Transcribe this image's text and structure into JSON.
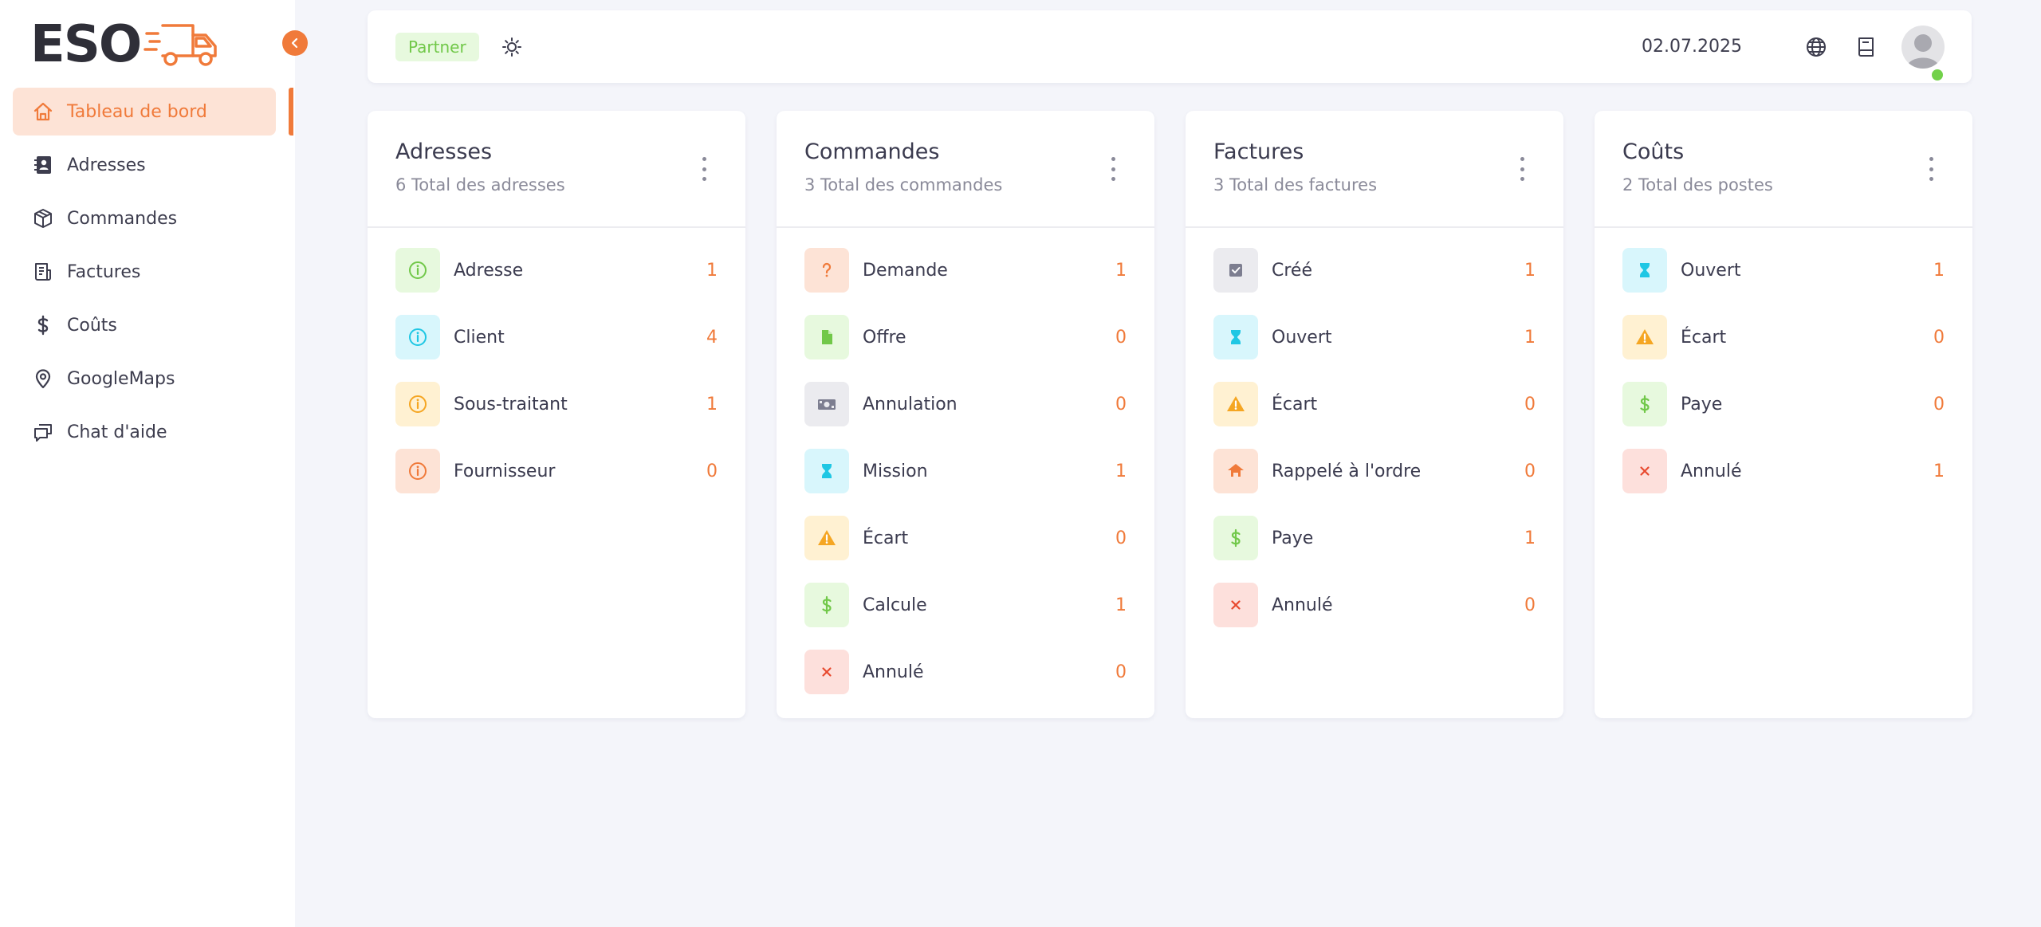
{
  "sidebar": {
    "logo_text": "ESO",
    "items": [
      {
        "label": "Tableau de bord",
        "icon": "home-icon"
      },
      {
        "label": "Adresses",
        "icon": "address-book-icon"
      },
      {
        "label": "Commandes",
        "icon": "package-icon"
      },
      {
        "label": "Factures",
        "icon": "invoice-icon"
      },
      {
        "label": "Coûts",
        "icon": "dollar-icon"
      },
      {
        "label": "GoogleMaps",
        "icon": "map-pin-icon"
      },
      {
        "label": "Chat d'aide",
        "icon": "chat-icon"
      }
    ]
  },
  "header": {
    "badge": "Partner",
    "date": "02.07.2025"
  },
  "cards": [
    {
      "title": "Adresses",
      "subtitle": "6 Total des adresses",
      "rows": [
        {
          "label": "Adresse",
          "count": "1",
          "icon": "info-icon",
          "tone": "green"
        },
        {
          "label": "Client",
          "count": "4",
          "icon": "info-icon",
          "tone": "cyan"
        },
        {
          "label": "Sous-traitant",
          "count": "1",
          "icon": "info-icon",
          "tone": "yellow"
        },
        {
          "label": "Fournisseur",
          "count": "0",
          "icon": "info-icon",
          "tone": "orange"
        }
      ]
    },
    {
      "title": "Commandes",
      "subtitle": "3 Total des commandes",
      "rows": [
        {
          "label": "Demande",
          "count": "1",
          "icon": "question-icon",
          "tone": "orange"
        },
        {
          "label": "Offre",
          "count": "0",
          "icon": "file-icon",
          "tone": "green"
        },
        {
          "label": "Annulation",
          "count": "0",
          "icon": "money-icon",
          "tone": "grey"
        },
        {
          "label": "Mission",
          "count": "1",
          "icon": "hourglass-icon",
          "tone": "cyan"
        },
        {
          "label": "Écart",
          "count": "0",
          "icon": "warning-icon",
          "tone": "yellow"
        },
        {
          "label": "Calcule",
          "count": "1",
          "icon": "dollar-icon",
          "tone": "green"
        },
        {
          "label": "Annulé",
          "count": "0",
          "icon": "close-icon",
          "tone": "red"
        }
      ]
    },
    {
      "title": "Factures",
      "subtitle": "3 Total des factures",
      "rows": [
        {
          "label": "Créé",
          "count": "1",
          "icon": "checkbox-icon",
          "tone": "grey"
        },
        {
          "label": "Ouvert",
          "count": "1",
          "icon": "hourglass-icon",
          "tone": "cyan"
        },
        {
          "label": "Écart",
          "count": "0",
          "icon": "warning-icon",
          "tone": "yellow"
        },
        {
          "label": "Rappelé à l'ordre",
          "count": "0",
          "icon": "reminder-icon",
          "tone": "orange"
        },
        {
          "label": "Paye",
          "count": "1",
          "icon": "dollar-icon",
          "tone": "green"
        },
        {
          "label": "Annulé",
          "count": "0",
          "icon": "close-icon",
          "tone": "red"
        }
      ]
    },
    {
      "title": "Coûts",
      "subtitle": "2 Total des postes",
      "rows": [
        {
          "label": "Ouvert",
          "count": "1",
          "icon": "hourglass-icon",
          "tone": "cyan"
        },
        {
          "label": "Écart",
          "count": "0",
          "icon": "warning-icon",
          "tone": "yellow"
        },
        {
          "label": "Paye",
          "count": "0",
          "icon": "dollar-icon",
          "tone": "green"
        },
        {
          "label": "Annulé",
          "count": "1",
          "icon": "close-icon",
          "tone": "red"
        }
      ]
    }
  ],
  "colors": {
    "accent": "#f07a3a",
    "green": "#71c849",
    "cyan": "#1fc7e4",
    "yellow": "#f5a623",
    "red": "#e8492e",
    "grey": "#7d7e90"
  }
}
